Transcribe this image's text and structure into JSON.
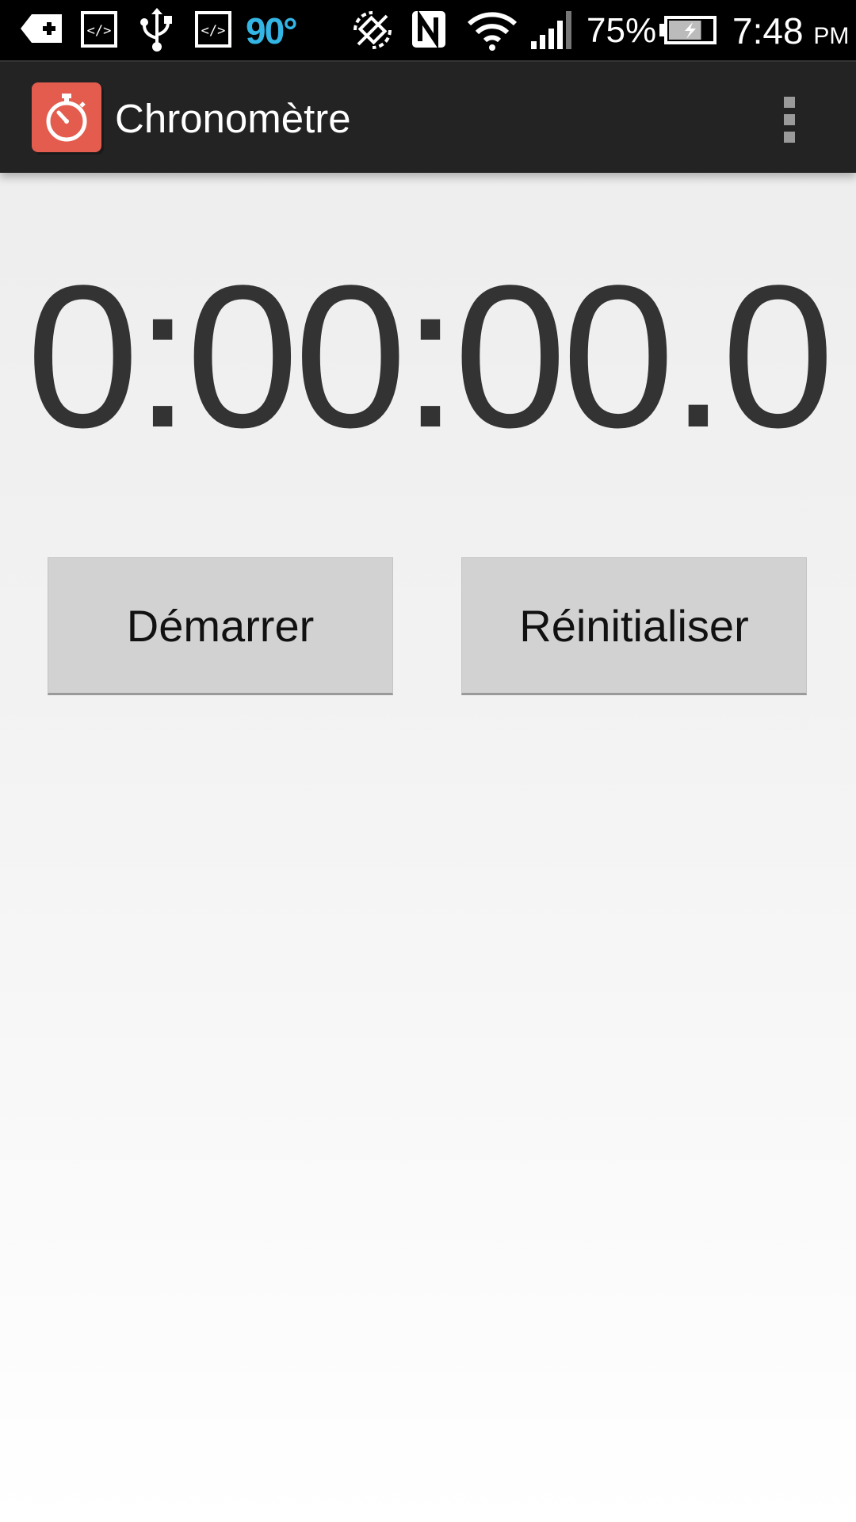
{
  "status_bar": {
    "temperature": "90°",
    "battery_percent": "75%",
    "battery_level": 0.75,
    "time": "7:48",
    "ampm": "PM",
    "icons": [
      "add-notification-icon",
      "code-icon",
      "usb-icon",
      "code-icon",
      "auto-rotate-off-icon",
      "nfc-icon",
      "wifi-icon",
      "signal-icon",
      "battery-charging-icon"
    ]
  },
  "app_bar": {
    "title": "Chronomètre",
    "icon": "stopwatch-icon",
    "menu_icon": "overflow-menu-icon"
  },
  "timer": {
    "display": "0:00:00.0"
  },
  "buttons": {
    "start": "Démarrer",
    "reset": "Réinitialiser"
  },
  "colors": {
    "app_icon": "#e35c4e",
    "action_bar": "#232323",
    "timer_text": "#333333",
    "temperature": "#33b5e5",
    "button_bg": "#d2d2d2"
  }
}
